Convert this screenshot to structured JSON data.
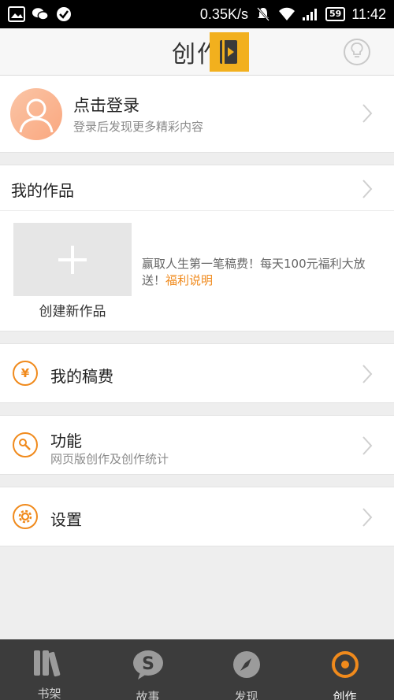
{
  "status_bar": {
    "speed": "0.35K/s",
    "battery": "59",
    "time": "11:42"
  },
  "header": {
    "title": "创作"
  },
  "login": {
    "title": "点击登录",
    "subtitle": "登录后发现更多精彩内容"
  },
  "works": {
    "title": "我的作品",
    "create_label": "创建新作品",
    "promo_text": "赢取人生第一笔稿费！每天100元福利大放送！",
    "promo_link": "福利说明"
  },
  "menu": {
    "royalty": {
      "title": "我的稿费",
      "icon": "yen-icon",
      "glyph": "¥"
    },
    "features": {
      "title": "功能",
      "subtitle": "网页版创作及创作统计",
      "icon": "wrench-icon"
    },
    "settings": {
      "title": "设置",
      "icon": "gear-icon"
    }
  },
  "bottom_nav": {
    "items": [
      {
        "label": "书架",
        "icon": "bookshelf-icon"
      },
      {
        "label": "故事",
        "icon": "story-icon"
      },
      {
        "label": "发现",
        "icon": "discover-icon"
      },
      {
        "label": "创作",
        "icon": "create-icon",
        "active": true
      }
    ]
  },
  "colors": {
    "accent": "#f08a1c",
    "badge": "#f2b01e",
    "nav_bg": "#3c3c3c"
  }
}
